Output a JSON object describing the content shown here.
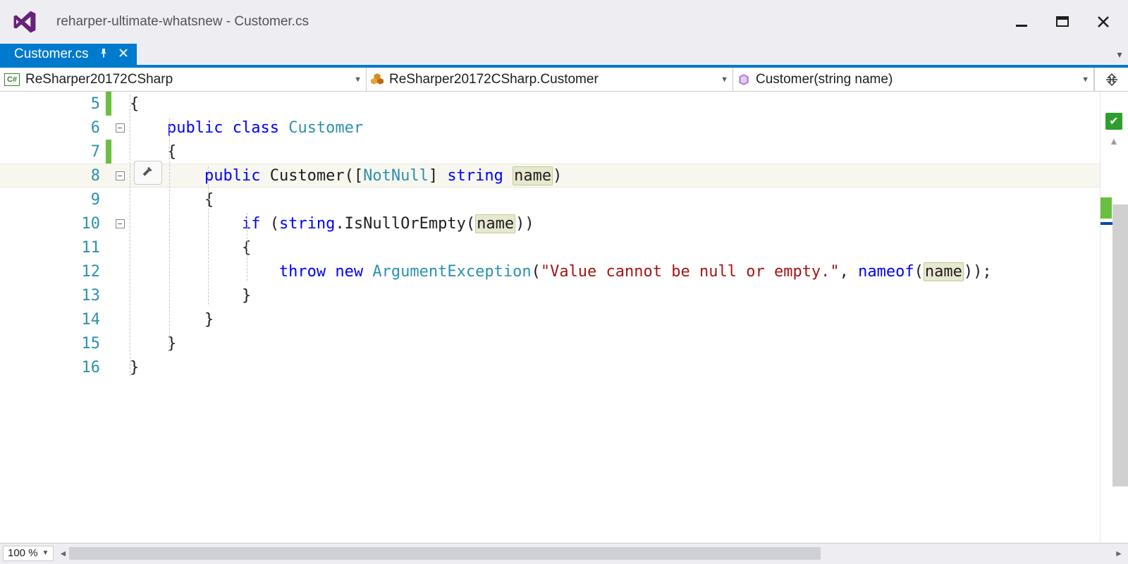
{
  "window": {
    "title": "reharper-ultimate-whatsnew - Customer.cs"
  },
  "tab": {
    "label": "Customer.cs"
  },
  "nav": {
    "namespace": "ReSharper20172CSharp",
    "class": "ReSharper20172CSharp.Customer",
    "member": "Customer(string name)"
  },
  "zoom": "100 %",
  "code": {
    "lines": [
      {
        "num": 5,
        "changed": true,
        "fold": "",
        "tokens": [
          {
            "t": "{",
            "c": ""
          }
        ]
      },
      {
        "num": 6,
        "changed": false,
        "fold": "minus",
        "tokens": [
          {
            "t": "    ",
            "c": ""
          },
          {
            "t": "public",
            "c": "kw"
          },
          {
            "t": " ",
            "c": ""
          },
          {
            "t": "class",
            "c": "kw"
          },
          {
            "t": " ",
            "c": ""
          },
          {
            "t": "Customer",
            "c": "type"
          }
        ]
      },
      {
        "num": 7,
        "changed": true,
        "fold": "",
        "tokens": [
          {
            "t": "    {",
            "c": ""
          }
        ]
      },
      {
        "num": 8,
        "changed": false,
        "fold": "minus",
        "current": true,
        "tokens": [
          {
            "t": "        ",
            "c": ""
          },
          {
            "t": "public",
            "c": "kw"
          },
          {
            "t": " Customer([",
            "c": ""
          },
          {
            "t": "NotNull",
            "c": "type"
          },
          {
            "t": "] ",
            "c": ""
          },
          {
            "t": "string",
            "c": "kw"
          },
          {
            "t": " ",
            "c": ""
          },
          {
            "t": "name",
            "c": "hl"
          },
          {
            "t": ")",
            "c": ""
          }
        ]
      },
      {
        "num": 9,
        "changed": false,
        "fold": "",
        "tokens": [
          {
            "t": "        {",
            "c": ""
          }
        ]
      },
      {
        "num": 10,
        "changed": false,
        "fold": "minus",
        "tokens": [
          {
            "t": "            ",
            "c": ""
          },
          {
            "t": "if",
            "c": "kw"
          },
          {
            "t": " (",
            "c": ""
          },
          {
            "t": "string",
            "c": "kw"
          },
          {
            "t": ".IsNullOrEmpty(",
            "c": ""
          },
          {
            "t": "name",
            "c": "hl"
          },
          {
            "t": "))",
            "c": ""
          }
        ]
      },
      {
        "num": 11,
        "changed": false,
        "fold": "",
        "tokens": [
          {
            "t": "            {",
            "c": ""
          }
        ]
      },
      {
        "num": 12,
        "changed": false,
        "fold": "",
        "tokens": [
          {
            "t": "                ",
            "c": ""
          },
          {
            "t": "throw",
            "c": "kw"
          },
          {
            "t": " ",
            "c": ""
          },
          {
            "t": "new",
            "c": "kw"
          },
          {
            "t": " ",
            "c": ""
          },
          {
            "t": "ArgumentException",
            "c": "type"
          },
          {
            "t": "(",
            "c": ""
          },
          {
            "t": "\"Value cannot be null or empty.\"",
            "c": "str"
          },
          {
            "t": ", ",
            "c": ""
          },
          {
            "t": "nameof",
            "c": "kw"
          },
          {
            "t": "(",
            "c": ""
          },
          {
            "t": "name",
            "c": "hl"
          },
          {
            "t": "));",
            "c": ""
          }
        ]
      },
      {
        "num": 13,
        "changed": false,
        "fold": "",
        "tokens": [
          {
            "t": "            }",
            "c": ""
          }
        ]
      },
      {
        "num": 14,
        "changed": false,
        "fold": "",
        "tokens": [
          {
            "t": "        }",
            "c": ""
          }
        ]
      },
      {
        "num": 15,
        "changed": false,
        "fold": "",
        "tokens": [
          {
            "t": "    }",
            "c": ""
          }
        ]
      },
      {
        "num": 16,
        "changed": false,
        "fold": "",
        "tokens": [
          {
            "t": "}",
            "c": ""
          }
        ]
      }
    ]
  }
}
